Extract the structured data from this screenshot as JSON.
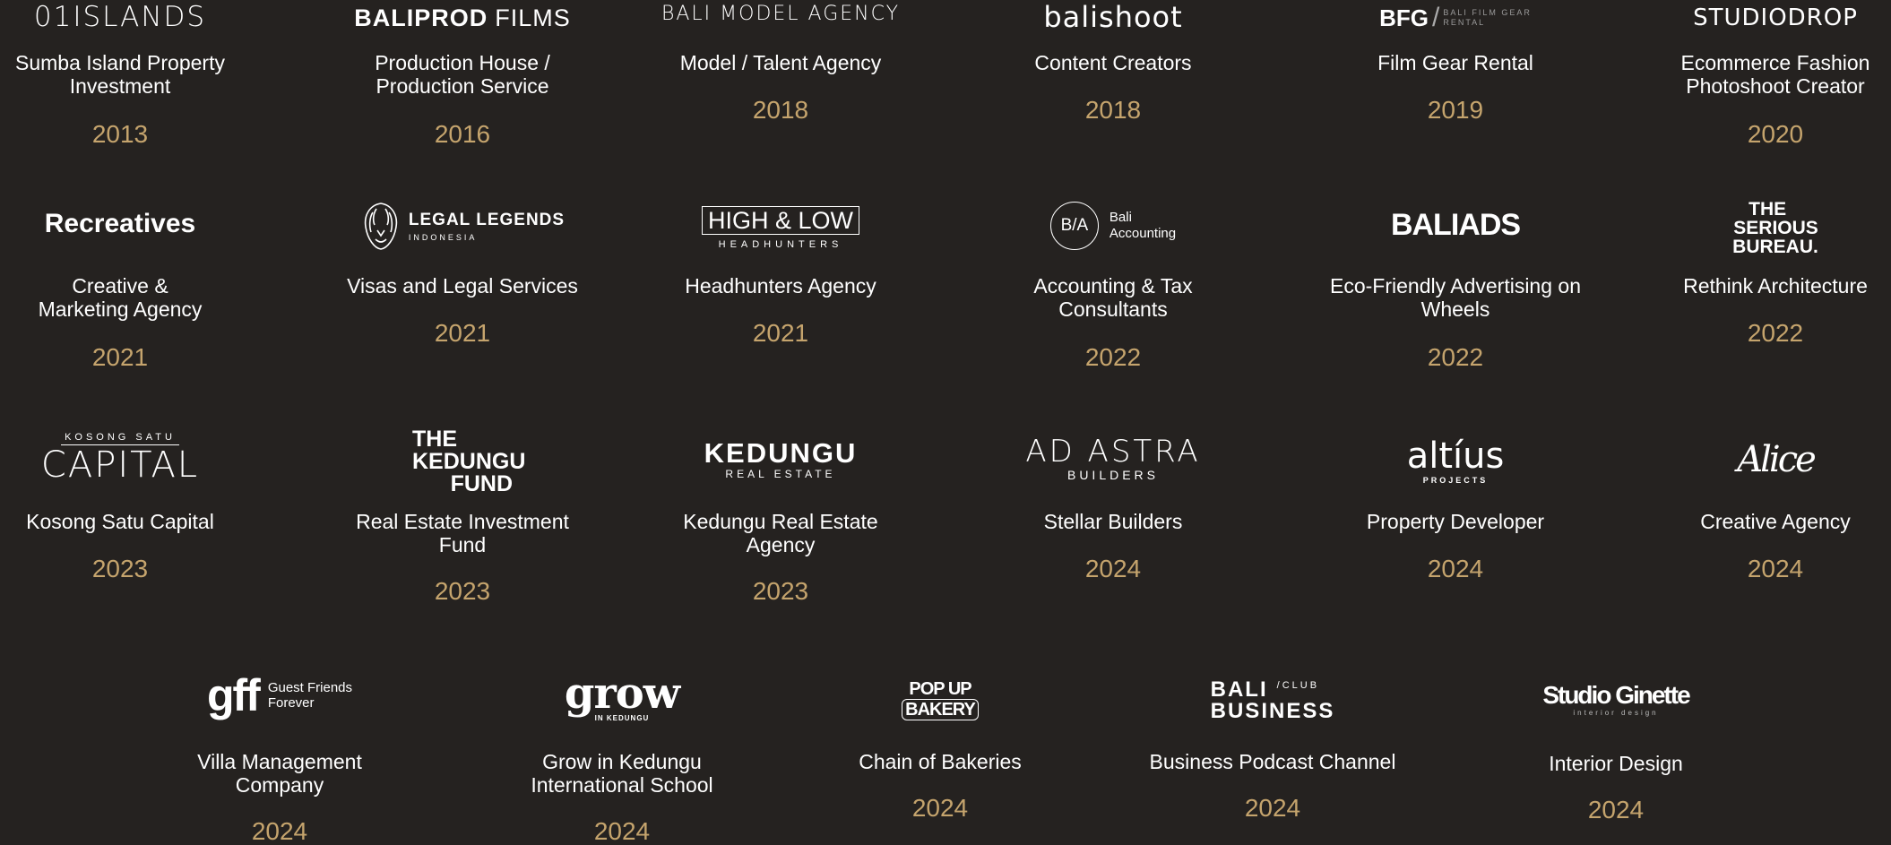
{
  "colors": {
    "background": "#252220",
    "text": "#ffffff",
    "year": "#c5a46d"
  },
  "row1": [
    {
      "logo": "01ISLANDS",
      "caption": "Sumba Island Property Investment",
      "year": "2013"
    },
    {
      "logo_a": "BALIPROD",
      "logo_b": "FILMS",
      "caption": "Production House / Production Service",
      "year": "2016"
    },
    {
      "logo": "BALI MODEL AGENCY",
      "caption": "Model / Talent Agency",
      "year": "2018"
    },
    {
      "logo": "balishoot",
      "caption": "Content Creators",
      "year": "2018"
    },
    {
      "logo_a": "BFG",
      "logo_b": "BALI FILM GEAR",
      "logo_c": "RENTAL",
      "caption": "Film Gear Rental",
      "year": "2019"
    },
    {
      "logo": "STUDIODROP",
      "caption": "Ecommerce Fashion Photoshoot Creator",
      "year": "2020"
    }
  ],
  "row2": [
    {
      "logo": "Recreatives",
      "caption": "Creative & Marketing Agency",
      "year": "2021"
    },
    {
      "logo_a": "LEGAL LEGENDS",
      "logo_b": "INDONESIA",
      "caption": "Visas and Legal Services",
      "year": "2021"
    },
    {
      "logo_a": "HIGH & LOW",
      "logo_b": "HEADHUNTERS",
      "caption": "Headhunters Agency",
      "year": "2021"
    },
    {
      "logo_mark": "B/A",
      "logo_a": "Bali",
      "logo_b": "Accounting",
      "caption": "Accounting & Tax Consultants",
      "year": "2022"
    },
    {
      "logo": "BALIADS",
      "caption": "Eco-Friendly Advertising on Wheels",
      "year": "2022"
    },
    {
      "logo_a": "THE",
      "logo_b": "SERIOUS",
      "logo_c": "BUREAU.",
      "caption": "Rethink Architecture",
      "year": "2022"
    }
  ],
  "row3": [
    {
      "logo_a": "KOSONG SATU",
      "logo_b": "CAPITAL",
      "caption": "Kosong Satu Capital",
      "year": "2023"
    },
    {
      "logo_a": "THE",
      "logo_b": "KEDUNGU",
      "logo_c": "FUND",
      "caption": "Real Estate Investment Fund",
      "year": "2023"
    },
    {
      "logo_a": "KEDUNGU",
      "logo_b": "REAL ESTATE",
      "caption": "Kedungu Real Estate Agency",
      "year": "2023"
    },
    {
      "logo_a": "AD ASTRA",
      "logo_b": "BUILDERS",
      "caption": "Stellar Builders",
      "year": "2024"
    },
    {
      "logo_a": "altíus",
      "logo_b": "PROJECTS",
      "caption": "Property Developer",
      "year": "2024"
    },
    {
      "logo": "Alice",
      "caption": "Creative Agency",
      "year": "2024"
    }
  ],
  "row4": [
    {
      "logo_a": "gff",
      "logo_b": "Guest Friends",
      "logo_c": "Forever",
      "caption": "Villa Management Company",
      "year": "2024"
    },
    {
      "logo_a": "grow",
      "logo_b": "IN KEDUNGU",
      "caption": "Grow in Kedungu International School",
      "year": "2024"
    },
    {
      "logo_a": "POP UP",
      "logo_b": "BAKERY",
      "caption": "Chain of Bakeries",
      "year": "2024"
    },
    {
      "logo_a": "BALI",
      "logo_b": "/CLUB",
      "logo_c": "BUSINESS",
      "caption": "Business Podcast Channel",
      "year": "2024"
    },
    {
      "logo_a": "Studio Ginette",
      "logo_b": "interior design",
      "caption": "Interior Design",
      "year": "2024"
    }
  ]
}
